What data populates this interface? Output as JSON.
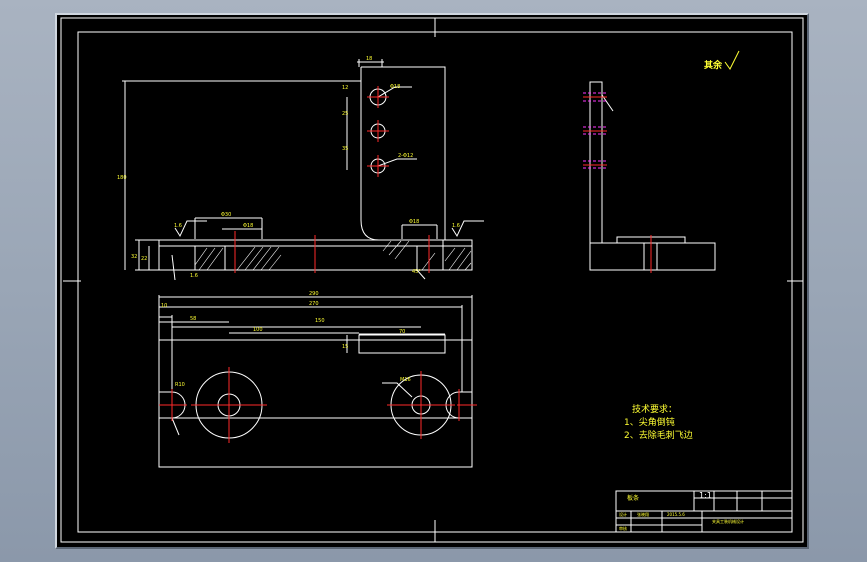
{
  "roughness_note": "其余",
  "tech_requirements": {
    "title": "技术要求：",
    "items": [
      "1、尖角倒钝",
      "2、去除毛刺飞边"
    ]
  },
  "front_view": {
    "dim_top": "18",
    "dim_hole1": "Φ18",
    "dim_holes": "2-Φ12",
    "dim_left_v1": "12",
    "dim_left_v2": "25",
    "dim_left_v3": "35",
    "dim_height": "180",
    "dim_base_h1": "32",
    "dim_base_h2": "22",
    "dim_cbore_left_a": "Φ30",
    "dim_cbore_left_b": "Φ18",
    "dim_cbore_right": "Φ18",
    "rough_left": "1.6",
    "rough_right": "1.6",
    "rough_bottom": "1.6",
    "dim_angle": "45°"
  },
  "top_view": {
    "dim_overall": "290",
    "dim_270": "270",
    "dim_10": "10",
    "dim_58": "58",
    "dim_150": "150",
    "dim_100": "100",
    "dim_70": "70",
    "dim_slot": "15",
    "dim_r_left": "R10",
    "dim_m16": "M16"
  },
  "title_block": {
    "scale": "1:1",
    "part_name": "板条",
    "drawn": "设计",
    "checked": "审核",
    "student": "张晓翔",
    "date": "2015.5.6",
    "school": "夹具工装机械设计"
  }
}
